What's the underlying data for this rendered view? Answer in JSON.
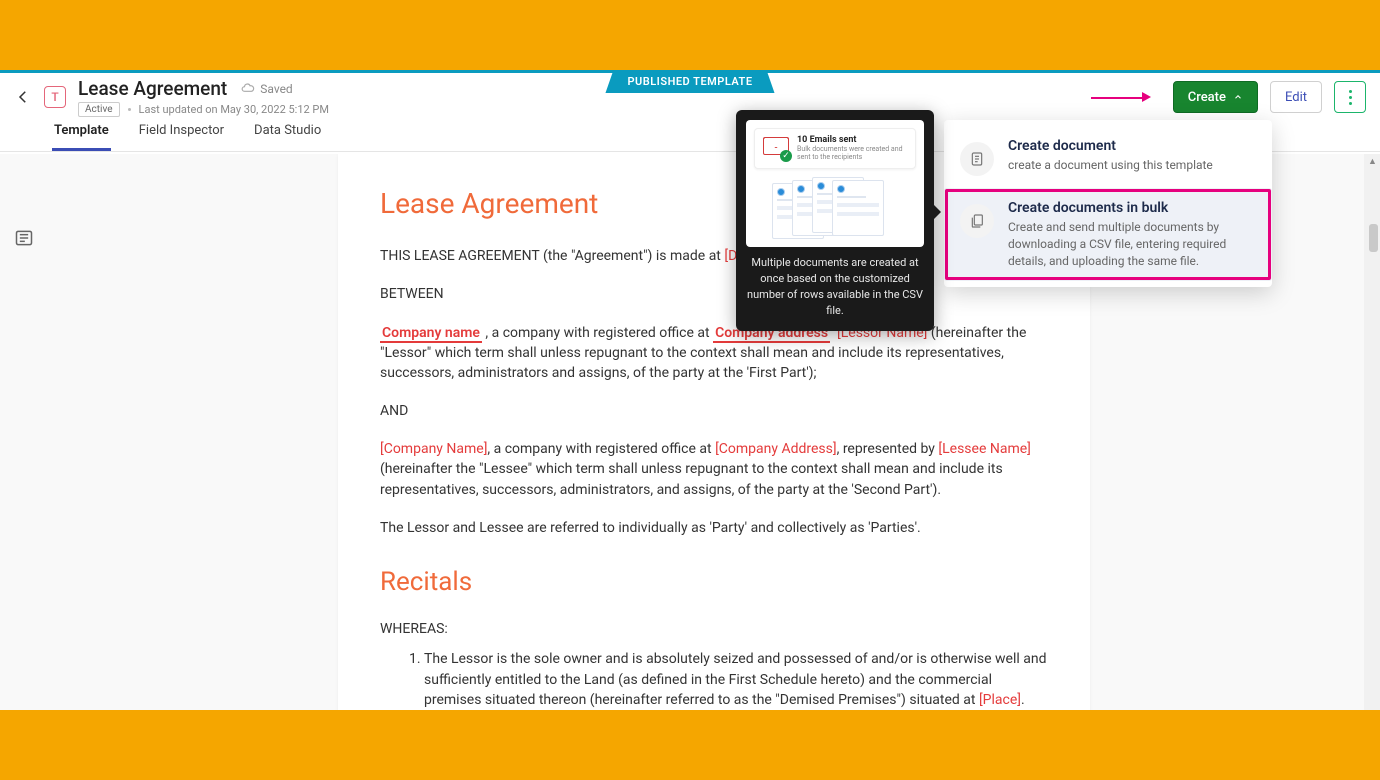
{
  "banner": {
    "label": "PUBLISHED TEMPLATE"
  },
  "header": {
    "badge_letter": "T",
    "title": "Lease Agreement",
    "saved_label": "Saved",
    "status_pill": "Active",
    "last_updated": "Last updated on May 30, 2022 5:12 PM",
    "create_label": "Create",
    "edit_label": "Edit"
  },
  "tabs": {
    "items": [
      "Template",
      "Field Inspector",
      "Data Studio"
    ],
    "active_index": 0
  },
  "document": {
    "h1": "Lease Agreement",
    "intro_prefix": "THIS LEASE AGREEMENT (the \"Agreement\") is made at ",
    "intro_date_ph": "[Date]",
    "between": "BETWEEN",
    "company_name_ph": "Company name",
    "company_mid1": " , a company with registered office at  ",
    "company_addr_ph_u": "Company address",
    "lessor_name_ph": "[Lessor Name]",
    "lessor_tail": " (hereinafter the \"Lessor\" which term shall unless repugnant to the context shall mean and include its representatives, successors, administrators and assigns, of the party at the 'First Part');",
    "and": "AND",
    "company_name2_ph": "[Company Name]",
    "company_mid2": ", a company with registered office at ",
    "company_addr2_ph": "[Company Address]",
    "represented_by": ", represented by ",
    "lessee_name_ph": "[Lessee Name]",
    "lessee_tail": " (hereinafter the \"Lessee\" which term shall unless repugnant to the context shall mean and include its representatives, successors, administrators, and assigns, of the party at the 'Second Part').",
    "parties_line": "The Lessor and Lessee are referred to individually as 'Party' and collectively as 'Parties'.",
    "h2": "Recitals",
    "whereas": "WHEREAS:",
    "rec1_a": "The Lessor is the sole owner and is absolutely seized and possessed of and/or is otherwise well and sufficiently entitled to the Land (as defined in the First Schedule hereto) and the commercial premises situated thereon (hereinafter referred to as the \"Demised Premises\") situated at ",
    "rec1_place": "[Place]",
    "rec1_b": "."
  },
  "create_menu": {
    "item1": {
      "title": "Create document",
      "desc": "create a document using this template"
    },
    "item2": {
      "title": "Create documents in bulk",
      "desc": "Create and send multiple documents by downloading a CSV file, entering required details, and uploading the same file."
    }
  },
  "tooltip": {
    "promo_title": "10 Emails sent",
    "promo_desc": "Bulk documents were created and sent to the recipients",
    "body": "Multiple documents are created at once based on the customized number of rows available in the CSV file."
  }
}
